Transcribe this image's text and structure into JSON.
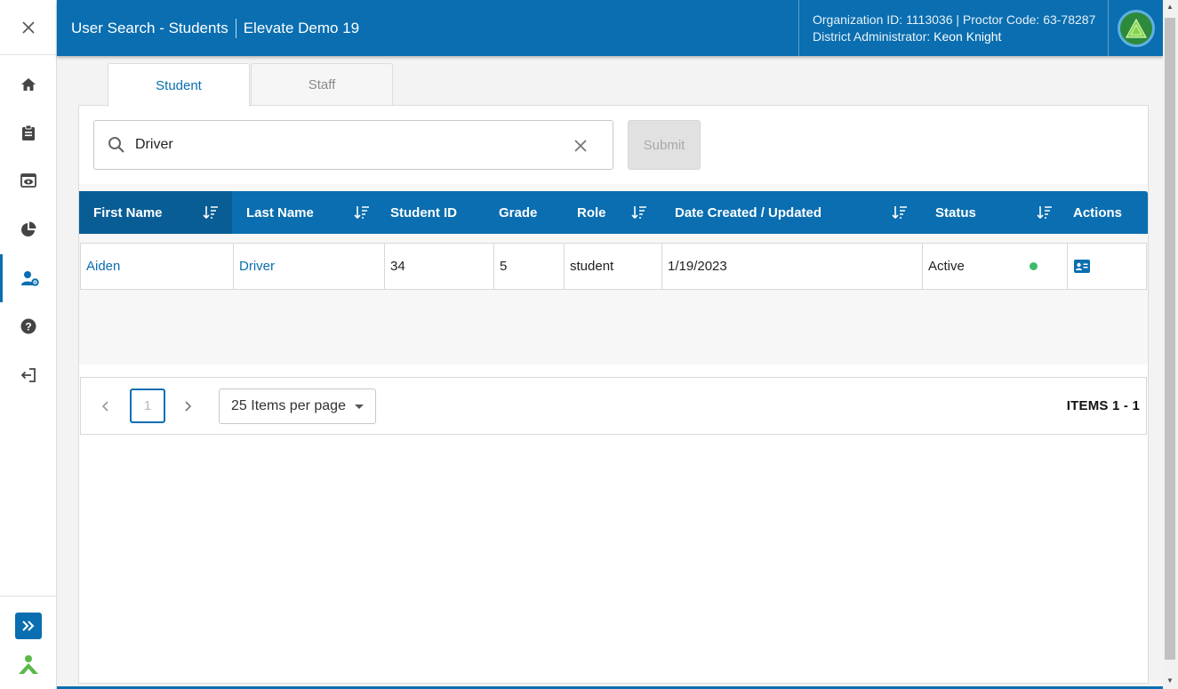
{
  "header": {
    "page_title": "User Search - Students",
    "org_name": "Elevate Demo 19",
    "org_id_label": "Organization ID:",
    "org_id": "1113036",
    "proctor_label": "Proctor Code:",
    "proctor_code": "63-78287",
    "role_label": "District Administrator:",
    "user_name": "Keon Knight"
  },
  "sidebar": {
    "items": [
      {
        "icon": "home-icon"
      },
      {
        "icon": "clipboard-icon"
      },
      {
        "icon": "eye-icon"
      },
      {
        "icon": "pie-chart-icon"
      },
      {
        "icon": "user-gear-icon",
        "active": true
      },
      {
        "icon": "help-icon"
      },
      {
        "icon": "logout-icon"
      }
    ]
  },
  "tabs": [
    {
      "label": "Student",
      "active": true
    },
    {
      "label": "Staff",
      "active": false
    }
  ],
  "search": {
    "value": "Driver",
    "submit_label": "Submit"
  },
  "table": {
    "columns": [
      "First Name",
      "Last Name",
      "Student ID",
      "Grade",
      "Role",
      "Date Created / Updated",
      "Status",
      "Actions"
    ],
    "rows": [
      {
        "first_name": "Aiden",
        "last_name": "Driver",
        "student_id": "34",
        "grade": "5",
        "role": "student",
        "date": "1/19/2023",
        "status": "Active",
        "status_color": "#3dbb6e"
      }
    ]
  },
  "pagination": {
    "current_page": "1",
    "per_page": "25 Items per page",
    "items_label": "ITEMS 1 - 1"
  },
  "colors": {
    "primary": "#0a6eb0",
    "primary_dark": "#085d95",
    "status_active": "#3dbb6e"
  }
}
